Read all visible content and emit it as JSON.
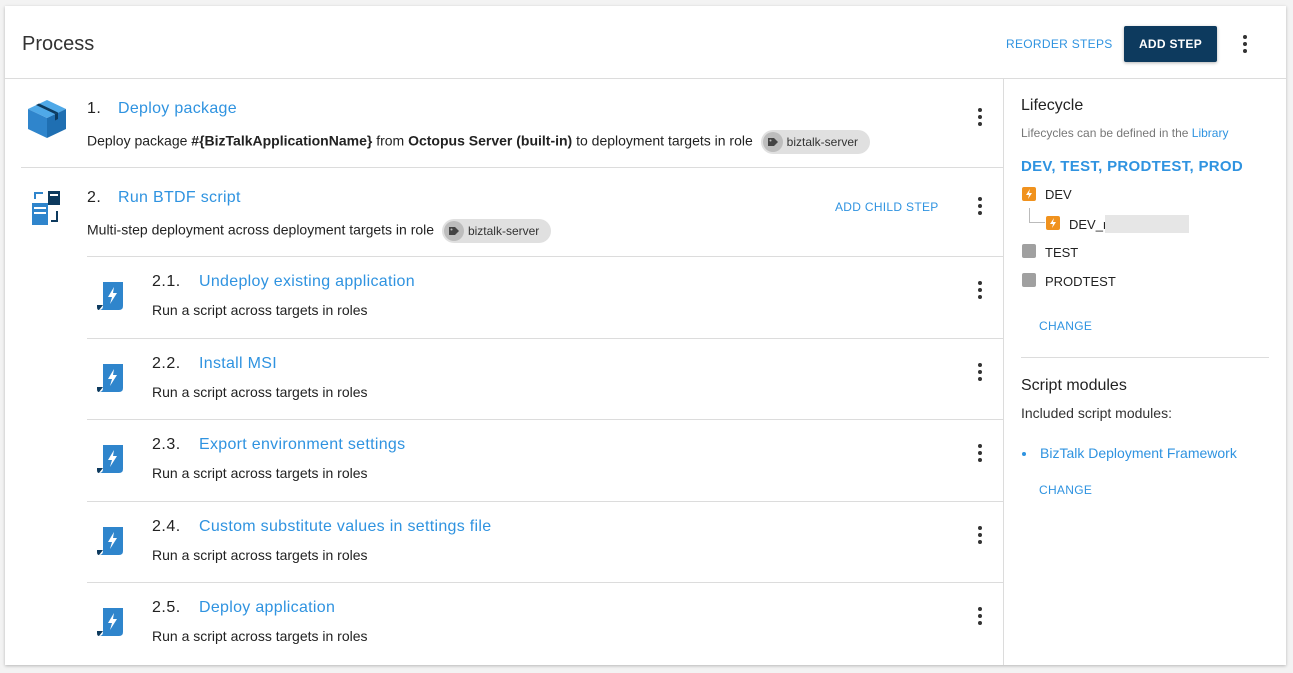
{
  "header": {
    "title": "Process",
    "reorder_label": "REORDER STEPS",
    "add_step_label": "ADD STEP"
  },
  "steps": [
    {
      "number": "1.",
      "title": "Deploy package",
      "desc_prefix": "Deploy package ",
      "desc_var": "#{BizTalkApplicationName}",
      "desc_mid": " from ",
      "desc_server": "Octopus Server (built-in)",
      "desc_suffix": " to deployment targets in role",
      "role": "biztalk-server",
      "icon": "package-icon"
    },
    {
      "number": "2.",
      "title": "Run BTDF script",
      "desc": "Multi-step deployment across deployment targets in role",
      "role": "biztalk-server",
      "add_child_label": "ADD CHILD STEP",
      "icon": "multi-step-icon",
      "children": [
        {
          "number": "2.1.",
          "title": "Undeploy existing application",
          "desc": "Run a script across targets in roles"
        },
        {
          "number": "2.2.",
          "title": "Install MSI",
          "desc": "Run a script across targets in roles"
        },
        {
          "number": "2.3.",
          "title": "Export environment settings",
          "desc": "Run a script across targets in roles"
        },
        {
          "number": "2.4.",
          "title": "Custom substitute values in settings file",
          "desc": "Run a script across targets in roles"
        },
        {
          "number": "2.5.",
          "title": "Deploy application",
          "desc": "Run a script across targets in roles"
        }
      ]
    }
  ],
  "sidebar": {
    "lifecycle_heading": "Lifecycle",
    "lifecycle_hint": "Lifecycles can be defined in the ",
    "lifecycle_hint_link": "Library",
    "lifecycle_name": "DEV, TEST, PRODTEST, PROD",
    "environments": [
      "DEV",
      "DEV_r",
      "TEST",
      "PRODTEST"
    ],
    "change_label": "CHANGE",
    "script_heading": "Script modules",
    "script_hint": "Included script modules:",
    "script_modules": [
      "BizTalk Deployment Framework"
    ],
    "change_label_2": "CHANGE"
  },
  "colors": {
    "accent": "#2f93e0",
    "primary_button": "#0d3a5e",
    "env_active": "#f0921e",
    "env_inactive": "#a0a0a0"
  }
}
